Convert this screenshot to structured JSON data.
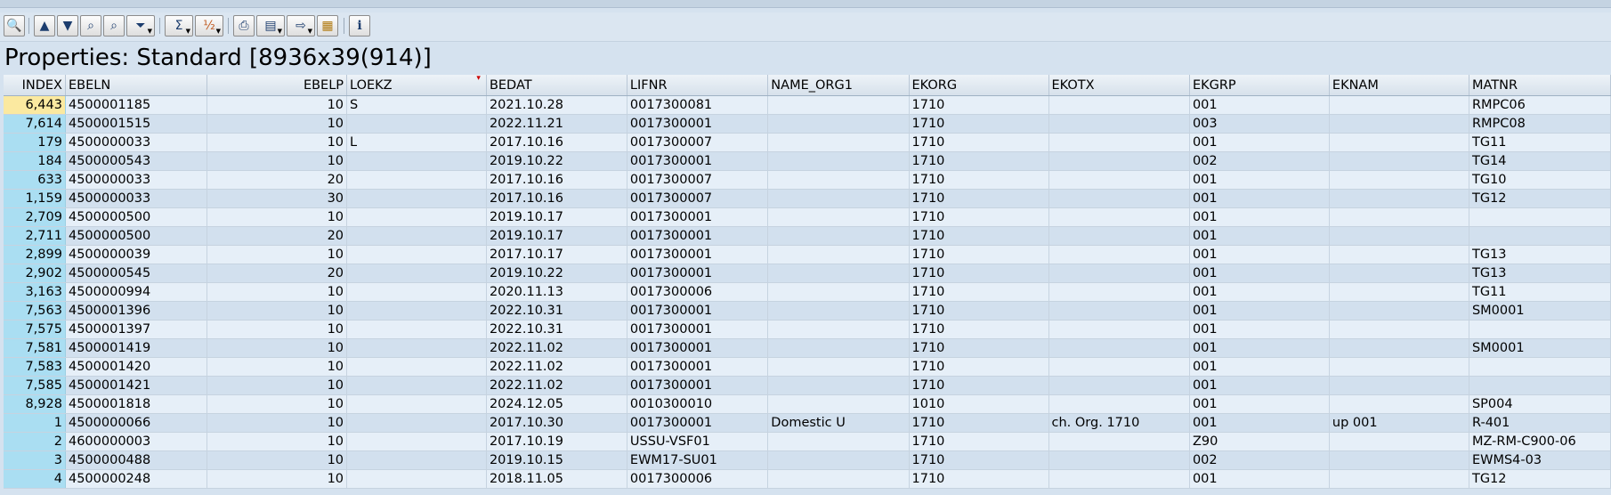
{
  "toolbar": {
    "buttons": [
      {
        "icon": "details-icon",
        "glyph": "🔍"
      },
      {
        "icon": "sort-ascending-icon",
        "glyph": "▲"
      },
      {
        "icon": "sort-descending-icon",
        "glyph": "▼"
      },
      {
        "icon": "find-icon",
        "glyph": "👁"
      },
      {
        "icon": "find-next-icon",
        "glyph": "👁"
      },
      {
        "icon": "filter-icon",
        "glyph": "▼"
      },
      {
        "icon": "sum-icon",
        "glyph": "Σ"
      },
      {
        "icon": "subtotal-icon",
        "glyph": "½"
      },
      {
        "icon": "print-preview-icon",
        "glyph": "🖶"
      },
      {
        "icon": "views-icon",
        "glyph": "▤"
      },
      {
        "icon": "export-icon",
        "glyph": "⇨"
      },
      {
        "icon": "layout-icon",
        "glyph": "▦"
      },
      {
        "icon": "information-icon",
        "glyph": "i"
      }
    ]
  },
  "title": "Properties: Standard [8936x39(914)]",
  "columns": [
    "INDEX",
    "EBELN",
    "EBELP",
    "LOEKZ",
    "BEDAT",
    "LIFNR",
    "NAME_ORG1",
    "EKORG",
    "EKOTX",
    "EKGRP",
    "EKNAM",
    "MATNR"
  ],
  "rows": [
    [
      "6,443",
      "4500001185",
      "10",
      "S",
      "2021.10.28",
      "0017300081",
      "",
      "1710",
      "",
      "001",
      "",
      "RMPC06"
    ],
    [
      "7,614",
      "4500001515",
      "10",
      "",
      "2022.11.21",
      "0017300001",
      "",
      "1710",
      "",
      "003",
      "",
      "RMPC08"
    ],
    [
      "179",
      "4500000033",
      "10",
      "L",
      "2017.10.16",
      "0017300007",
      "",
      "1710",
      "",
      "001",
      "",
      "TG11"
    ],
    [
      "184",
      "4500000543",
      "10",
      "",
      "2019.10.22",
      "0017300001",
      "",
      "1710",
      "",
      "002",
      "",
      "TG14"
    ],
    [
      "633",
      "4500000033",
      "20",
      "",
      "2017.10.16",
      "0017300007",
      "",
      "1710",
      "",
      "001",
      "",
      "TG10"
    ],
    [
      "1,159",
      "4500000033",
      "30",
      "",
      "2017.10.16",
      "0017300007",
      "",
      "1710",
      "",
      "001",
      "",
      "TG12"
    ],
    [
      "2,709",
      "4500000500",
      "10",
      "",
      "2019.10.17",
      "0017300001",
      "",
      "1710",
      "",
      "001",
      "",
      ""
    ],
    [
      "2,711",
      "4500000500",
      "20",
      "",
      "2019.10.17",
      "0017300001",
      "",
      "1710",
      "",
      "001",
      "",
      ""
    ],
    [
      "2,899",
      "4500000039",
      "10",
      "",
      "2017.10.17",
      "0017300001",
      "",
      "1710",
      "",
      "001",
      "",
      "TG13"
    ],
    [
      "2,902",
      "4500000545",
      "20",
      "",
      "2019.10.22",
      "0017300001",
      "",
      "1710",
      "",
      "001",
      "",
      "TG13"
    ],
    [
      "3,163",
      "4500000994",
      "10",
      "",
      "2020.11.13",
      "0017300006",
      "",
      "1710",
      "",
      "001",
      "",
      "TG11"
    ],
    [
      "7,563",
      "4500001396",
      "10",
      "",
      "2022.10.31",
      "0017300001",
      "",
      "1710",
      "",
      "001",
      "",
      "SM0001"
    ],
    [
      "7,575",
      "4500001397",
      "10",
      "",
      "2022.10.31",
      "0017300001",
      "",
      "1710",
      "",
      "001",
      "",
      ""
    ],
    [
      "7,581",
      "4500001419",
      "10",
      "",
      "2022.11.02",
      "0017300001",
      "",
      "1710",
      "",
      "001",
      "",
      "SM0001"
    ],
    [
      "7,583",
      "4500001420",
      "10",
      "",
      "2022.11.02",
      "0017300001",
      "",
      "1710",
      "",
      "001",
      "",
      ""
    ],
    [
      "7,585",
      "4500001421",
      "10",
      "",
      "2022.11.02",
      "0017300001",
      "",
      "1710",
      "",
      "001",
      "",
      ""
    ],
    [
      "8,928",
      "4500001818",
      "10",
      "",
      "2024.12.05",
      "0010300010",
      "",
      "1010",
      "",
      "001",
      "",
      "SP004"
    ],
    [
      "1",
      "4500000066",
      "10",
      "",
      "2017.10.30",
      "0017300001",
      "Domestic U",
      "1710",
      "ch. Org. 1710",
      "001",
      "up 001",
      "R-401"
    ],
    [
      "2",
      "4600000003",
      "10",
      "",
      "2017.10.19",
      "USSU-VSF01",
      "",
      "1710",
      "",
      "Z90",
      "",
      "MZ-RM-C900-06"
    ],
    [
      "3",
      "4500000488",
      "10",
      "",
      "2019.10.15",
      "EWM17-SU01",
      "",
      "1710",
      "",
      "002",
      "",
      "EWMS4-03"
    ],
    [
      "4",
      "4500000248",
      "10",
      "",
      "2018.11.05",
      "0017300006",
      "",
      "1710",
      "",
      "001",
      "",
      "TG12"
    ]
  ]
}
